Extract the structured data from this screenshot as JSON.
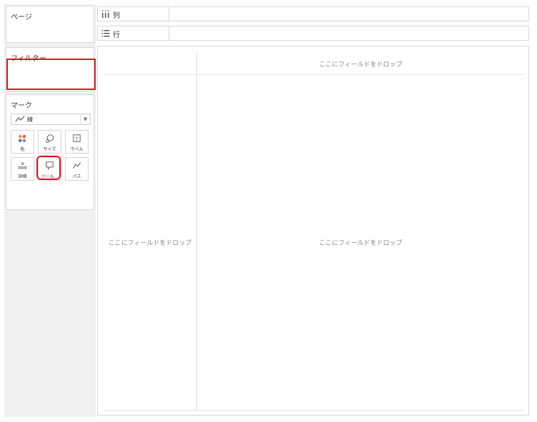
{
  "pages": {
    "title": "ページ"
  },
  "filters": {
    "title": "フィルター"
  },
  "marks": {
    "title": "マーク",
    "mark_type": {
      "label": "線",
      "icon": "line-chart-icon"
    },
    "buttons": [
      {
        "label": "色",
        "icon": "color-dots-icon"
      },
      {
        "label": "サイズ",
        "icon": "size-icon"
      },
      {
        "label": "ラベル",
        "icon": "label-icon"
      },
      {
        "label": "詳細",
        "icon": "detail-icon"
      },
      {
        "label": "ツール...",
        "icon": "tooltip-icon"
      },
      {
        "label": "パス",
        "icon": "path-icon"
      }
    ]
  },
  "shelves": {
    "columns": {
      "label": "列",
      "icon": "columns-icon"
    },
    "rows": {
      "label": "行",
      "icon": "rows-icon"
    }
  },
  "view": {
    "drop_top": "ここにフィールドをドロップ",
    "drop_left": "ここにフィールドをドロップ",
    "drop_center": "ここにフィールドをドロップ"
  },
  "colors": {
    "highlight": "#e0141e",
    "dot_orange": "#f28e2b",
    "dot_red": "#e15759",
    "dot_blue": "#4e79a7",
    "dot_purple": "#b07aa1"
  }
}
